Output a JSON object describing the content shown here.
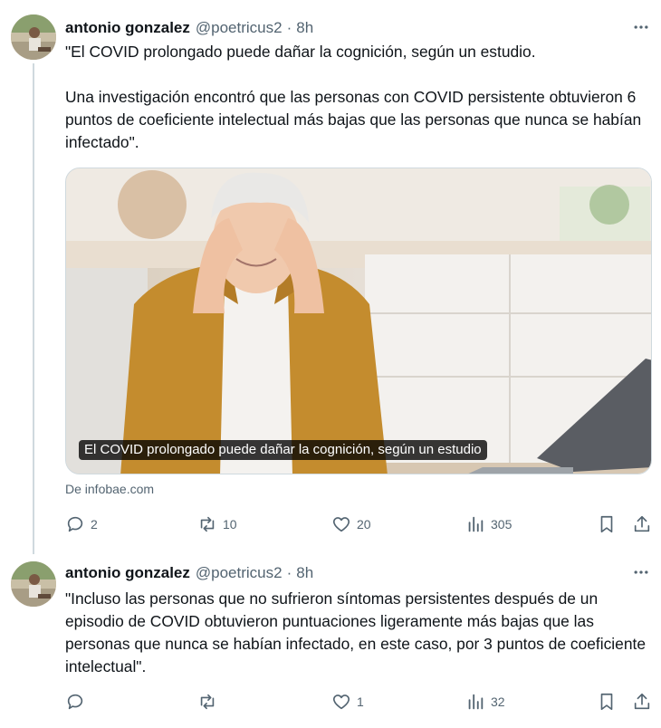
{
  "tweets": [
    {
      "author": {
        "name": "antonio gonzalez",
        "handle": "@poetricus2",
        "separator": "·",
        "time": "8h"
      },
      "text": "\"El COVID prolongado puede dañar la cognición, según un estudio.\n\nUna investigación encontró que las personas con COVID persistente obtuvieron 6 puntos de coeficiente intelectual más bajas que las personas que nunca se habían infectado\".",
      "card": {
        "caption": "El COVID prolongado puede dañar la cognición, según un estudio",
        "source": "De infobae.com"
      },
      "stats": {
        "replies": "2",
        "retweets": "10",
        "likes": "20",
        "views": "305"
      }
    },
    {
      "author": {
        "name": "antonio gonzalez",
        "handle": "@poetricus2",
        "separator": "·",
        "time": "8h"
      },
      "text": "\"Incluso las personas que no sufrieron síntomas persistentes después de un episodio de COVID obtuvieron puntuaciones ligeramente más bajas que las personas que nunca se habían infectado, en este caso, por 3 puntos de coeficiente intelectual\".",
      "stats": {
        "replies": "",
        "retweets": "",
        "likes": "1",
        "views": "32"
      }
    }
  ],
  "icons": {
    "more": "more-horizontal-icon",
    "reply": "reply-bubble-icon",
    "retweet": "retweet-arrows-icon",
    "like": "heart-icon",
    "views": "bar-chart-icon",
    "bookmark": "bookmark-icon",
    "share": "share-upload-icon"
  },
  "colors": {
    "text": "#0f1419",
    "secondary": "#536471",
    "border": "#cfd9de",
    "background": "#ffffff"
  }
}
